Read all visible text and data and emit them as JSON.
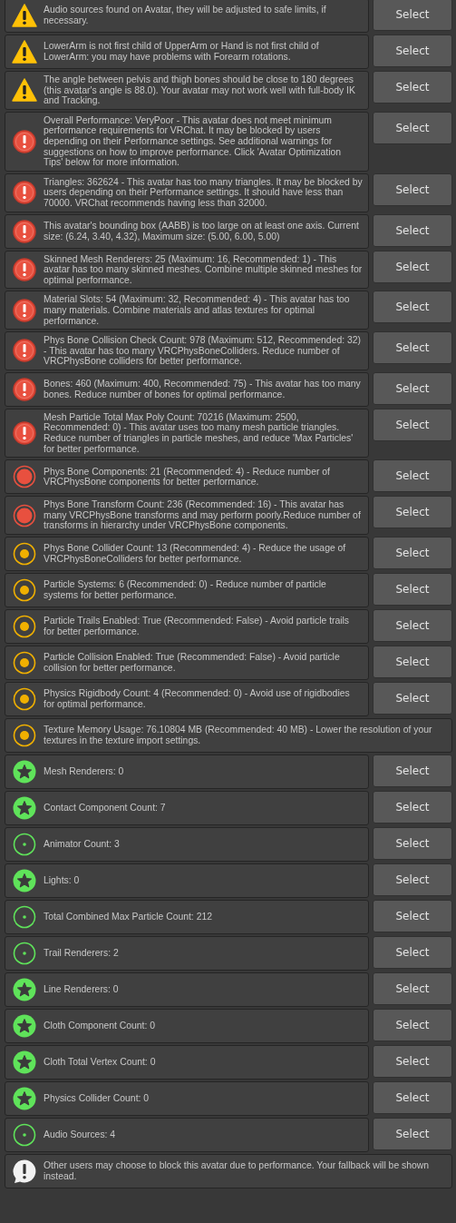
{
  "messages": [
    {
      "kind": "warning",
      "text": "Audio sources found on Avatar, they will be adjusted to safe limits, if necessary.",
      "button": "Select"
    },
    {
      "kind": "warning",
      "text": "LowerArm is not first child of UpperArm or Hand is not first child of LowerArm: you may have problems with Forearm rotations.",
      "button": "Select"
    },
    {
      "kind": "warning",
      "text": "The angle between pelvis and thigh bones should be close to 180 degrees (this avatar's angle is 88.0). Your avatar may not work well with full-body IK and Tracking.",
      "button": "Select"
    },
    {
      "kind": "error",
      "text": "Overall Performance: VeryPoor - This avatar does not meet minimum performance requirements for VRChat. It may be blocked by users depending on their Performance settings. See additional warnings for suggestions on how to improve performance. Click 'Avatar Optimization Tips' below for more information.",
      "button": "Select"
    },
    {
      "kind": "error",
      "text": "Triangles: 362624 - This avatar has too many triangles. It may be blocked by users depending on their Performance settings. It should have less than 70000. VRChat recommends having less than 32000.",
      "button": "Select"
    },
    {
      "kind": "error",
      "text": "This avatar's bounding box (AABB) is too large on at least one axis. Current size: (6.24, 3.40, 4.32), Maximum size: (5.00, 6.00, 5.00)",
      "button": "Select"
    },
    {
      "kind": "error",
      "text": "Skinned Mesh Renderers: 25 (Maximum: 16, Recommended: 1) - This avatar has too many skinned meshes. Combine multiple skinned meshes for optimal performance.",
      "button": "Select"
    },
    {
      "kind": "error",
      "text": "Material Slots: 54 (Maximum: 32, Recommended: 4) - This avatar has too many materials. Combine materials and atlas textures for optimal performance.",
      "button": "Select"
    },
    {
      "kind": "error",
      "text": "Phys Bone Collision Check Count: 978 (Maximum: 512, Recommended: 32) - This avatar has too many VRCPhysBoneColliders. Reduce number of VRCPhysBone colliders for better performance.",
      "button": "Select"
    },
    {
      "kind": "error",
      "text": "Bones: 460 (Maximum: 400, Recommended: 75) - This avatar has too many bones. Reduce number of bones for optimal performance.",
      "button": "Select"
    },
    {
      "kind": "error",
      "text": "Mesh Particle Total Max Poly Count: 70216 (Maximum: 2500, Recommended: 0) - This avatar uses too many mesh particle triangles. Reduce number of triangles in particle meshes, and reduce 'Max Particles' for better performance.",
      "button": "Select"
    },
    {
      "kind": "verypoor",
      "text": "Phys Bone Components: 21 (Recommended: 4) - Reduce number of VRCPhysBone components for better performance.",
      "button": "Select"
    },
    {
      "kind": "verypoor",
      "text": "Phys Bone Transform Count: 236 (Recommended: 16) - This avatar has many VRCPhysBone transforms and may perform poorly.Reduce number of transforms in hierarchy under VRCPhysBone components.",
      "button": "Select"
    },
    {
      "kind": "poor",
      "text": "Phys Bone Collider Count: 13 (Recommended: 4) - Reduce the usage of VRCPhysBoneColliders for better performance.",
      "button": "Select"
    },
    {
      "kind": "poor",
      "text": "Particle Systems: 6 (Recommended: 0) - Reduce number of particle systems for better performance.",
      "button": "Select"
    },
    {
      "kind": "poor",
      "text": "Particle Trails Enabled: True (Recommended: False) - Avoid particle trails for better performance.",
      "button": "Select"
    },
    {
      "kind": "poor",
      "text": "Particle Collision Enabled: True (Recommended: False) - Avoid particle collision for better performance.",
      "button": "Select"
    },
    {
      "kind": "poor",
      "text": "Physics Rigidbody Count: 4 (Recommended: 0) - Avoid use of rigidbodies for optimal performance.",
      "button": "Select"
    },
    {
      "kind": "poor",
      "text": "Texture Memory Usage: 76.10804 MB (Recommended: 40 MB) - Lower the resolution of your textures in the texture import settings."
    },
    {
      "kind": "excellent",
      "text": "Mesh Renderers: 0",
      "button": "Select"
    },
    {
      "kind": "excellent",
      "text": "Contact Component Count: 7",
      "button": "Select"
    },
    {
      "kind": "good",
      "text": "Animator Count: 3",
      "button": "Select"
    },
    {
      "kind": "excellent",
      "text": "Lights: 0",
      "button": "Select"
    },
    {
      "kind": "good",
      "text": "Total Combined Max Particle Count: 212",
      "button": "Select"
    },
    {
      "kind": "good",
      "text": "Trail Renderers: 2",
      "button": "Select"
    },
    {
      "kind": "excellent",
      "text": "Line Renderers: 0",
      "button": "Select"
    },
    {
      "kind": "excellent",
      "text": "Cloth Component Count: 0",
      "button": "Select"
    },
    {
      "kind": "excellent",
      "text": "Cloth Total Vertex Count: 0",
      "button": "Select"
    },
    {
      "kind": "excellent",
      "text": "Physics Collider Count: 0",
      "button": "Select"
    },
    {
      "kind": "good",
      "text": "Audio Sources: 4",
      "button": "Select"
    },
    {
      "kind": "info",
      "text": "Other users may choose to block this avatar due to performance. Your fallback will be shown instead."
    }
  ]
}
